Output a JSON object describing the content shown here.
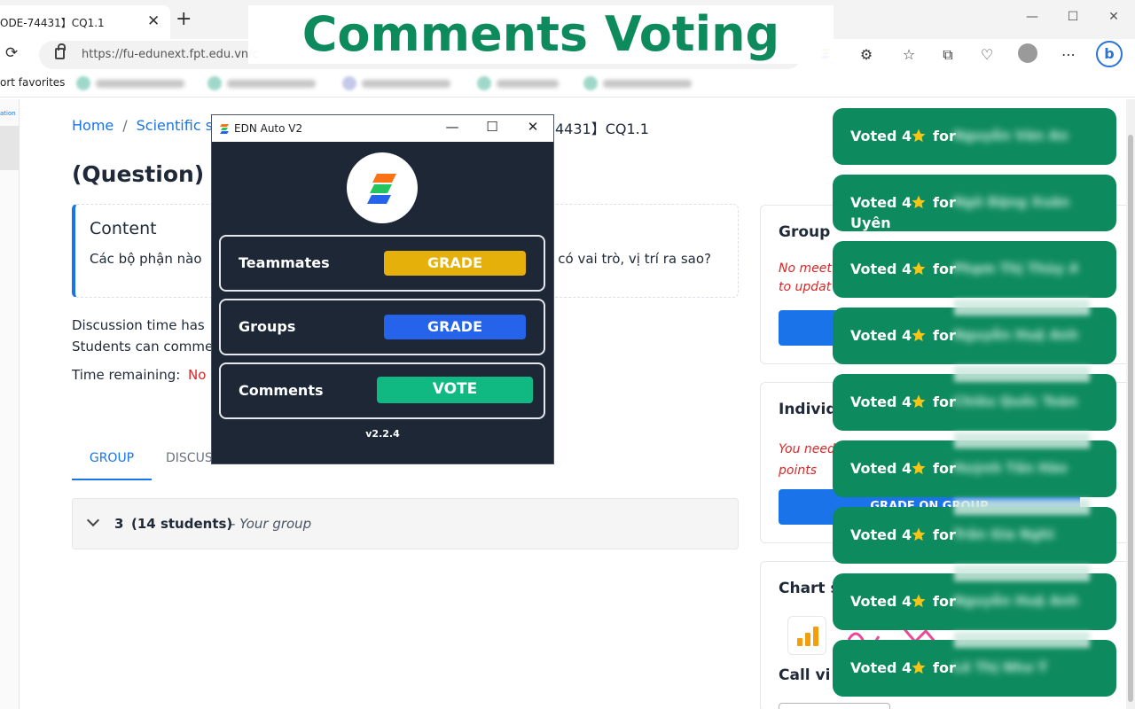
{
  "browser": {
    "tab_title": "ODE-74431】CQ1.1",
    "tab_close": "✕",
    "new_tab": "+",
    "window_buttons": [
      "—",
      "☐",
      "✕"
    ],
    "url": "https://fu-edunext.fpt.edu.vn/c",
    "favorites_label": "ort favorites",
    "favorites": [
      "item-1",
      "item-2",
      "item-3",
      "item-4",
      "item-5",
      "item-6"
    ]
  },
  "overlay_banner": "Comments Voting",
  "page": {
    "left_strip_text": "ation",
    "breadcrumb": {
      "home": "Home",
      "separator": "/",
      "item2": "Scientific s",
      "tail": "4431】CQ1.1"
    },
    "title": "(Question) 【",
    "content": {
      "heading": "Content",
      "text_start": "Các bộ phận nào",
      "text_end": "n có vai trò, vị trí ra sao?"
    },
    "discussion_line1": "Discussion time has",
    "discussion_line2": "Students can comme",
    "time_label": "Time remaining:",
    "time_value": "No",
    "tabs": {
      "group": "GROUP",
      "discussion": "DISCUS"
    },
    "group_row": {
      "number": "3",
      "count": "(14 students)",
      "note": "- Your group"
    },
    "right_cards": {
      "group_title": "Group",
      "group_red_line1": "No meet",
      "group_red_line2": "to updat",
      "individual_title": "Individ",
      "individual_red_line1": "You need",
      "individual_red_line2": "points",
      "individual_button": "GRADE ON GROUP",
      "chart_title": "Chart s",
      "call_title": "Call vi"
    }
  },
  "edn_window": {
    "title": "EDN Auto V2",
    "buttons": [
      "—",
      "☐",
      "✕"
    ],
    "rows": [
      {
        "label": "Teammates",
        "button": "GRADE",
        "color": "#e5b00a"
      },
      {
        "label": "Groups",
        "button": "GRADE",
        "color": "#2563eb"
      },
      {
        "label": "Comments",
        "button": "VOTE",
        "color": "#10b981"
      }
    ],
    "version": "v2.2.4"
  },
  "toasts": [
    {
      "voted": "Voted 4",
      "for": "for",
      "name": "Nguyễn Văn An",
      "name_line2": ""
    },
    {
      "voted": "Voted 4",
      "for": "for",
      "name": "Ngô Đặng Xuân",
      "name_line2": "Uyên"
    },
    {
      "voted": "Voted 4",
      "for": "for",
      "name": "Phạm Thị Thùy An",
      "name_line2": ""
    },
    {
      "voted": "Voted 4",
      "for": "for",
      "name": "Nguyễn Huệ Anh",
      "name_line2": ""
    },
    {
      "voted": "Voted 4",
      "for": "for",
      "name": "Chiêu Quốc Toàn",
      "name_line2": ""
    },
    {
      "voted": "Voted 4",
      "for": "for",
      "name": "Huỳnh Tấn Hào",
      "name_line2": ""
    },
    {
      "voted": "Voted 4",
      "for": "for",
      "name": "Trần Gia Nghi",
      "name_line2": ""
    },
    {
      "voted": "Voted 4",
      "for": "for",
      "name": "Nguyễn Huệ Anh",
      "name_line2": ""
    },
    {
      "voted": "Voted 4",
      "for": "for",
      "name": "Lê Thị Như Ý",
      "name_line2": ""
    }
  ],
  "colors": {
    "accent": "#1a73e8",
    "toast_green": "#0e8a5f",
    "banner_green": "#0d8b5c",
    "edn_bg": "#1e2736",
    "star": "#f5c518",
    "warning_red": "#dc2626"
  },
  "icons": [
    "reload-icon",
    "lock-icon",
    "extensions-icon",
    "favorites-icon",
    "collections-icon",
    "performance-icon",
    "more-icon",
    "bing-icon",
    "star-icon",
    "chevron-down-icon",
    "edn-logo-icon",
    "bar-chart-icon"
  ]
}
